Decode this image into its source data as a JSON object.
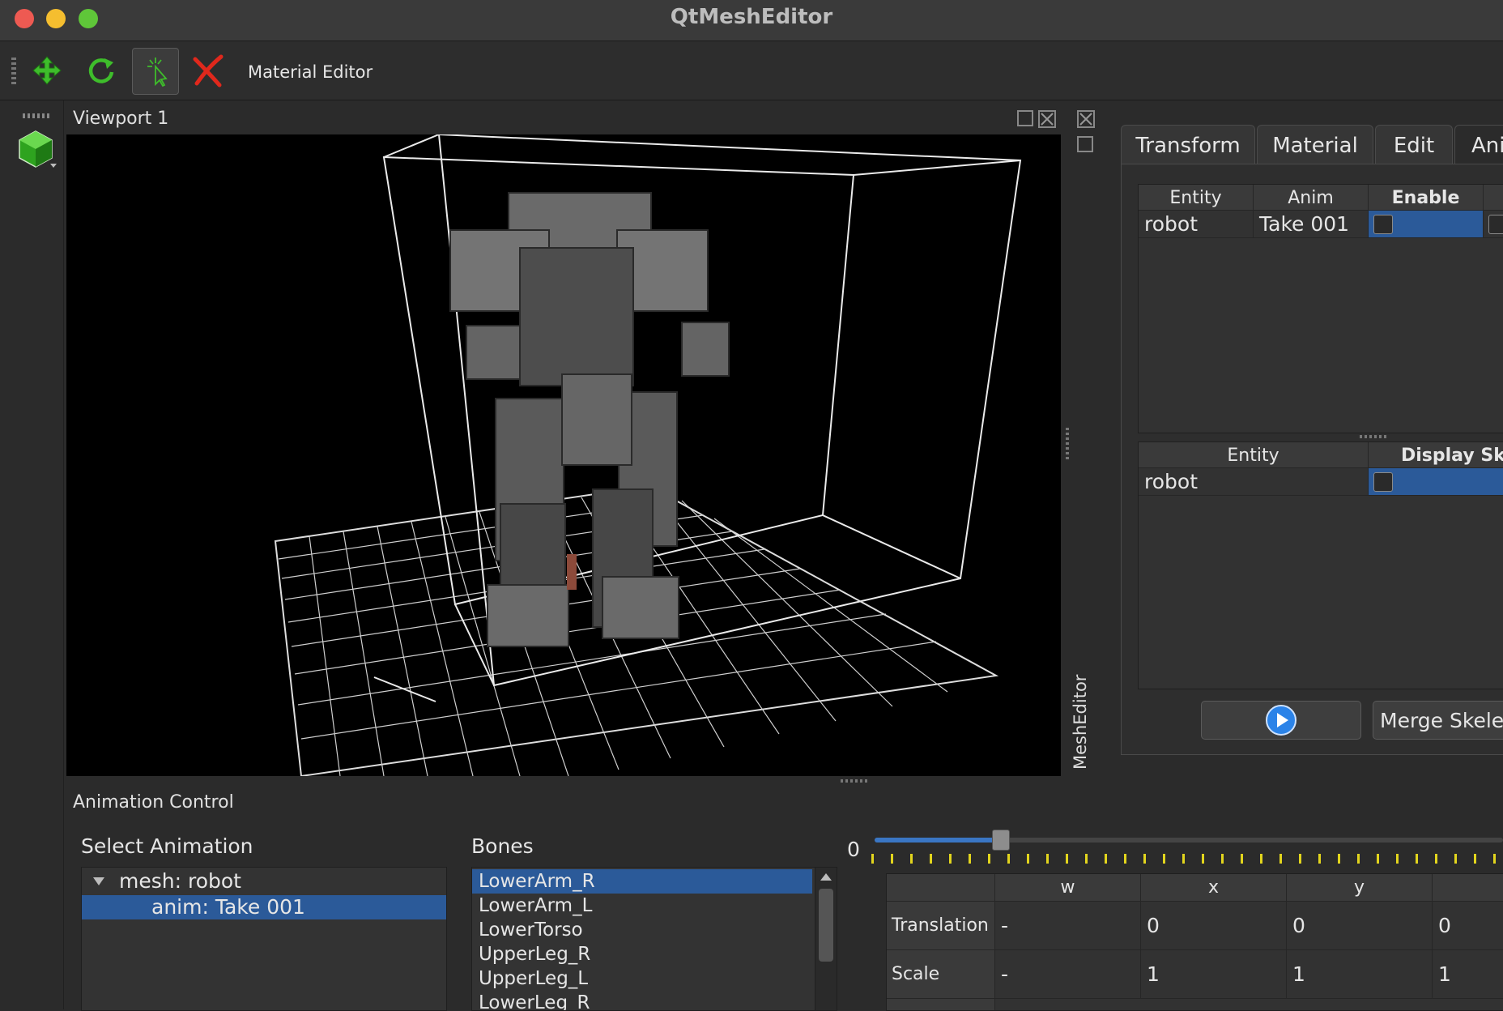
{
  "window": {
    "title": "QtMeshEditor"
  },
  "toolbar": {
    "material_editor_label": "Material Editor"
  },
  "viewport": {
    "title": "Viewport 1"
  },
  "dock": {
    "vertical_title": "MeshEditor"
  },
  "tabs": [
    {
      "label": "Transform"
    },
    {
      "label": "Material"
    },
    {
      "label": "Edit"
    },
    {
      "label": "Ani"
    }
  ],
  "anim_table": {
    "headers": [
      "Entity",
      "Anim",
      "Enable"
    ],
    "rows": [
      {
        "entity": "robot",
        "anim": "Take 001"
      }
    ]
  },
  "skeleton_table": {
    "headers": [
      "Entity",
      "Display Sk"
    ],
    "rows": [
      {
        "entity": "robot"
      }
    ]
  },
  "buttons": {
    "merge_label": "Merge Skelet"
  },
  "animation_control": {
    "title": "Animation Control",
    "select_animation_label": "Select Animation",
    "tree": [
      {
        "label": "mesh: robot"
      },
      {
        "label": "anim: Take 001"
      }
    ],
    "bones_label": "Bones",
    "bones": [
      "LowerArm_R",
      "LowerArm_L",
      "LowerTorso",
      "UpperLeg_R",
      "UpperLeg_L",
      "LowerLeg_R"
    ],
    "time_value": "0",
    "slider_fraction": 0.2,
    "kv_headers": [
      "w",
      "x",
      "y"
    ],
    "kv_rows": [
      {
        "label": "Translation",
        "w": "-",
        "x": "0",
        "y": "0",
        "z": "0"
      },
      {
        "label": "Scale",
        "w": "-",
        "x": "1",
        "y": "1",
        "z": "1"
      }
    ]
  },
  "colors": {
    "selection": "#2b5a99",
    "accent_green": "#3ebd2b",
    "tick_yellow": "#e2d51d"
  }
}
